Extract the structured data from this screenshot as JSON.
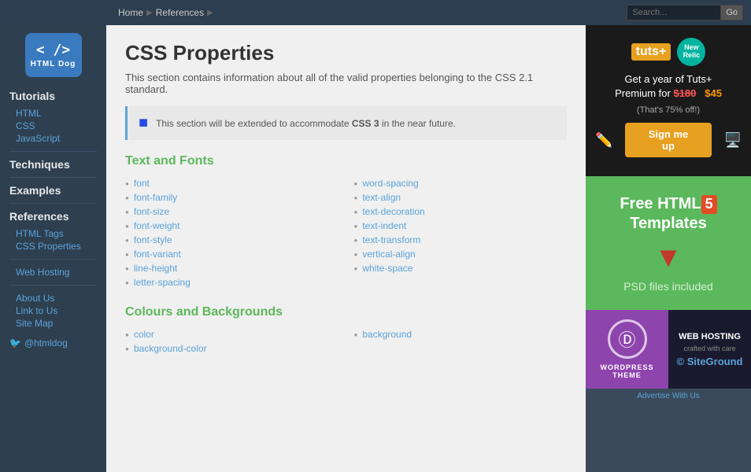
{
  "topbar": {
    "breadcrumbs": [
      "Home",
      "References"
    ],
    "search_placeholder": "Search..."
  },
  "logo": {
    "icons": "< />",
    "text": "HTML Dog"
  },
  "sidebar": {
    "tutorials_heading": "Tutorials",
    "tutorials_links": [
      "HTML",
      "CSS",
      "JavaScript"
    ],
    "techniques_heading": "Techniques",
    "examples_heading": "Examples",
    "references_heading": "References",
    "references_links": [
      "HTML Tags",
      "CSS Properties"
    ],
    "hosting_link": "Web Hosting",
    "misc_links": [
      "About Us",
      "Link to Us",
      "Site Map"
    ],
    "twitter": "@htmldog"
  },
  "main": {
    "title": "CSS Properties",
    "intro": "This section contains information about all of the valid properties belonging to the CSS 2.1 standard.",
    "css3_notice": "This section will be extended to accommodate CSS 3 in the near future.",
    "text_fonts_heading": "Text and Fonts",
    "text_fonts_links": [
      "font",
      "font-family",
      "font-size",
      "font-weight",
      "font-style",
      "font-variant",
      "line-height",
      "letter-spacing",
      "word-spacing",
      "text-align",
      "text-decoration",
      "text-indent",
      "text-transform",
      "vertical-align",
      "white-space"
    ],
    "colours_heading": "Colours and Backgrounds",
    "colours_links": [
      "color",
      "background-color",
      "background"
    ],
    "background_color_label": "background color"
  },
  "ads": {
    "tuts_logo": "tuts+",
    "tuts_badge": "New\nRelic",
    "tuts_heading": "Get a year of Tuts+\nPremium for",
    "tuts_price_old": "$180",
    "tuts_price_new": "$45",
    "tuts_discount": "(That's 75% off!)",
    "tuts_signup": "Sign me up",
    "html5_heading": "Free HTML",
    "html5_badge": "5",
    "html5_sub_heading": "Templates",
    "html5_sub": "PSD files included",
    "wp_text": "WORDPRESS THEME",
    "sg_title": "WEB HOSTING",
    "sg_sub": "crafted with care",
    "sg_brand": "© SiteGround",
    "advertise": "Advertise With Us"
  }
}
